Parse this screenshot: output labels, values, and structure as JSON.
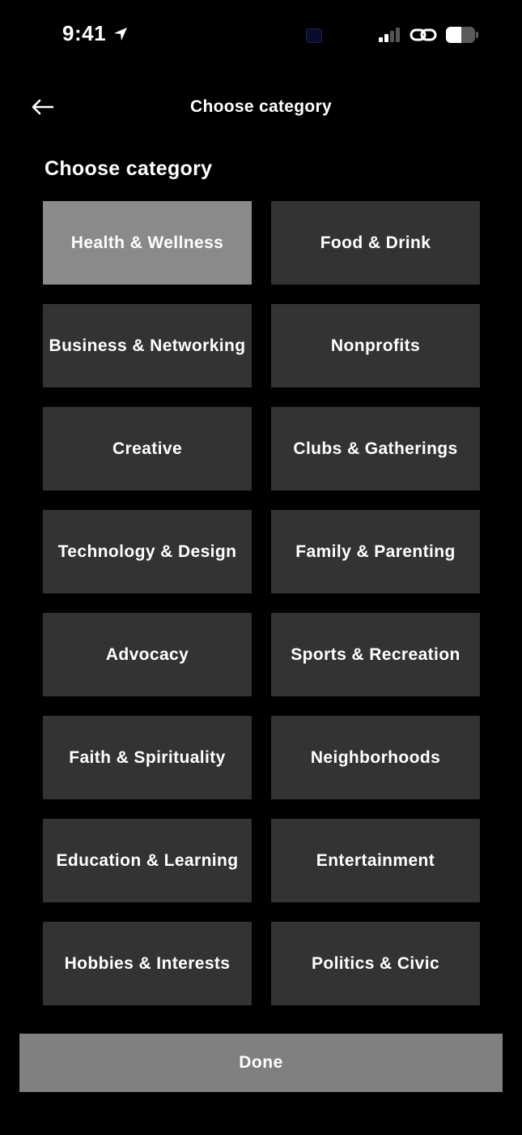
{
  "status_bar": {
    "time": "9:41",
    "icons": [
      "location-arrow-icon",
      "signal-icon",
      "link-icon",
      "battery-icon"
    ]
  },
  "header": {
    "title": "Choose category",
    "back_icon": "back-arrow-icon"
  },
  "section": {
    "title": "Choose category"
  },
  "colors": {
    "background": "#000000",
    "tile": "#333333",
    "tile_selected": "#8a8a8a",
    "done_button": "#808080",
    "text": "#ffffff"
  },
  "categories": [
    {
      "label": "Health & Wellness",
      "selected": true
    },
    {
      "label": "Food & Drink",
      "selected": false
    },
    {
      "label": "Business & Networking",
      "selected": false
    },
    {
      "label": "Nonprofits",
      "selected": false
    },
    {
      "label": "Creative",
      "selected": false
    },
    {
      "label": "Clubs & Gatherings",
      "selected": false
    },
    {
      "label": "Technology & Design",
      "selected": false
    },
    {
      "label": "Family & Parenting",
      "selected": false
    },
    {
      "label": "Advocacy",
      "selected": false
    },
    {
      "label": "Sports & Recreation",
      "selected": false
    },
    {
      "label": "Faith & Spirituality",
      "selected": false
    },
    {
      "label": "Neighborhoods",
      "selected": false
    },
    {
      "label": "Education & Learning",
      "selected": false
    },
    {
      "label": "Entertainment",
      "selected": false
    },
    {
      "label": "Hobbies & Interests",
      "selected": false
    },
    {
      "label": "Politics & Civic",
      "selected": false
    }
  ],
  "footer": {
    "done_label": "Done"
  }
}
